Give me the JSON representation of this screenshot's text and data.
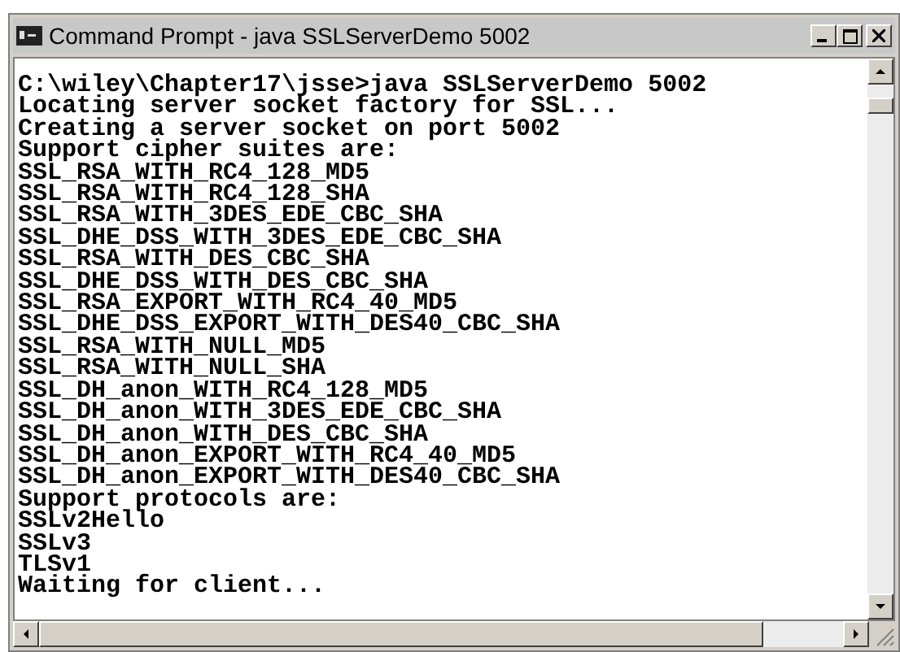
{
  "window": {
    "title": "Command Prompt - java SSLServerDemo 5002"
  },
  "console": {
    "lines": [
      "C:\\wiley\\Chapter17\\jsse>java SSLServerDemo 5002",
      "Locating server socket factory for SSL...",
      "Creating a server socket on port 5002",
      "Support cipher suites are:",
      "SSL_RSA_WITH_RC4_128_MD5",
      "SSL_RSA_WITH_RC4_128_SHA",
      "SSL_RSA_WITH_3DES_EDE_CBC_SHA",
      "SSL_DHE_DSS_WITH_3DES_EDE_CBC_SHA",
      "SSL_RSA_WITH_DES_CBC_SHA",
      "SSL_DHE_DSS_WITH_DES_CBC_SHA",
      "SSL_RSA_EXPORT_WITH_RC4_40_MD5",
      "SSL_DHE_DSS_EXPORT_WITH_DES40_CBC_SHA",
      "SSL_RSA_WITH_NULL_MD5",
      "SSL_RSA_WITH_NULL_SHA",
      "SSL_DH_anon_WITH_RC4_128_MD5",
      "SSL_DH_anon_WITH_3DES_EDE_CBC_SHA",
      "SSL_DH_anon_WITH_DES_CBC_SHA",
      "SSL_DH_anon_EXPORT_WITH_RC4_40_MD5",
      "SSL_DH_anon_EXPORT_WITH_DES40_CBC_SHA",
      "Support protocols are:",
      "SSLv2Hello",
      "SSLv3",
      "TLSv1",
      "Waiting for client..."
    ]
  }
}
